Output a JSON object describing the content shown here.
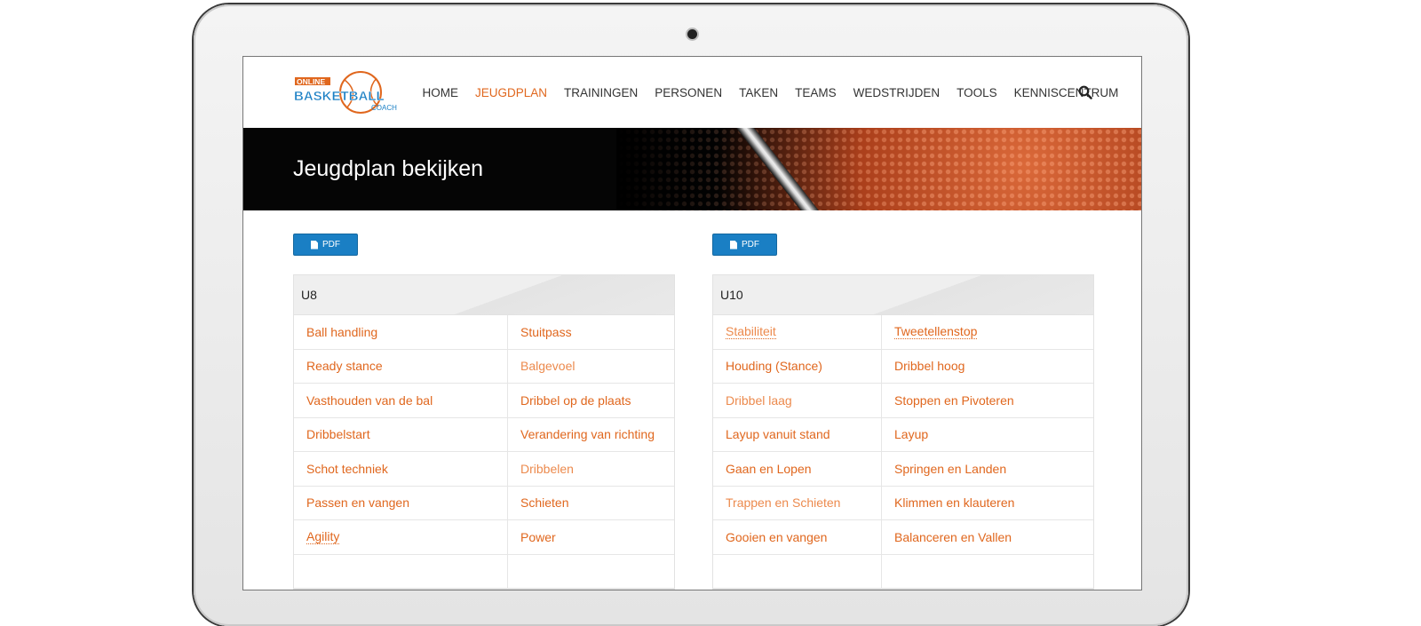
{
  "logo": {
    "top": "ONLINE",
    "middle": "BASKETBALL",
    "bottom": "COACH",
    "colors": {
      "orange": "#e0671e",
      "blue": "#1a7fc4"
    }
  },
  "nav": {
    "items": [
      "HOME",
      "JEUGDPLAN",
      "TRAININGEN",
      "PERSONEN",
      "TAKEN",
      "TEAMS",
      "WEDSTRIJDEN",
      "TOOLS",
      "KENNISCENTRUM"
    ],
    "active": "JEUGDPLAN"
  },
  "banner": {
    "title": "Jeugdplan bekijken"
  },
  "buttons": {
    "pdf_left": "PDF",
    "pdf_right": "PDF"
  },
  "panels": [
    {
      "title": "U8",
      "left": [
        "Ball handling",
        "Ready stance",
        "Vasthouden van de bal",
        "Dribbelstart",
        "Schot techniek",
        "Passen en vangen",
        "Agility"
      ],
      "right": [
        "Stuitpass",
        "Balgevoel",
        "Dribbel op de plaats",
        "Verandering van richting",
        "Dribbelen",
        "Schieten",
        "Power"
      ]
    },
    {
      "title": "U10",
      "left": [
        "Stabiliteit",
        "Houding (Stance)",
        "Dribbel laag",
        "Layup vanuit stand",
        "Gaan en Lopen",
        "Trappen en Schieten",
        "Gooien en vangen"
      ],
      "right": [
        "Tweetellenstop",
        "Dribbel hoog",
        "Stoppen en Pivoteren",
        "Layup",
        "Springen en Landen",
        "Klimmen en klauteren",
        "Balanceren en Vallen"
      ]
    }
  ]
}
